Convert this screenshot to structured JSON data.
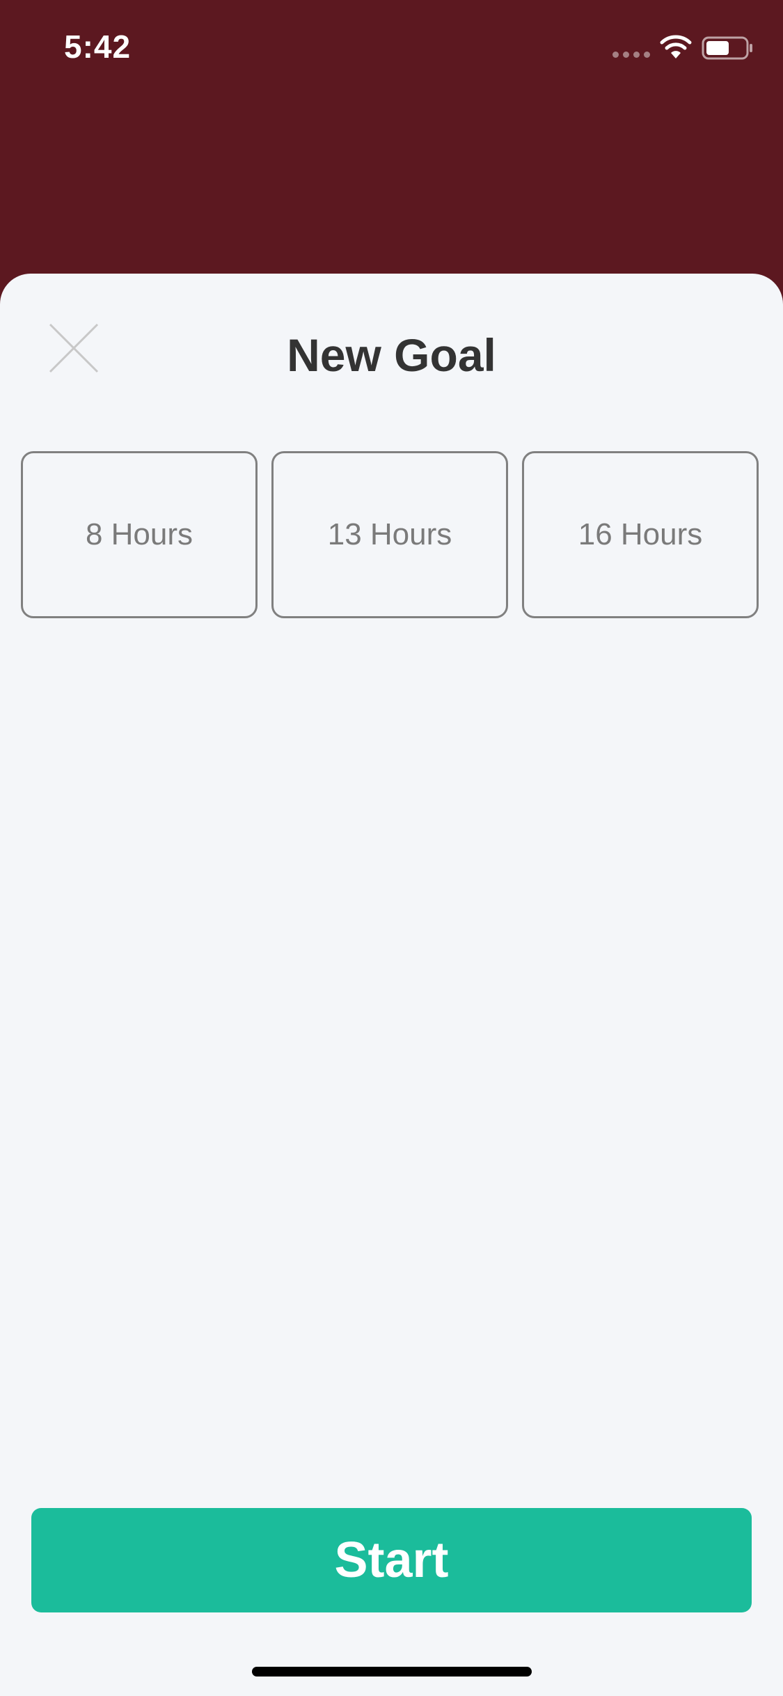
{
  "status_bar": {
    "time": "5:42",
    "signal_icon": "cellular-signal-icon",
    "wifi_icon": "wifi-icon",
    "battery_icon": "battery-icon",
    "battery_level": 0.6
  },
  "header": {
    "title": "New Goal",
    "close_icon": "close-icon"
  },
  "goal_options": [
    {
      "label": "8 Hours"
    },
    {
      "label": "13 Hours"
    },
    {
      "label": "16 Hours"
    }
  ],
  "footer": {
    "start_label": "Start"
  },
  "colors": {
    "header_background": "#5c1820",
    "sheet_background": "#f4f6f9",
    "accent": "#1bbc9b",
    "title_text": "#333333",
    "option_border": "#808080",
    "option_text": "#7a7a7a"
  }
}
